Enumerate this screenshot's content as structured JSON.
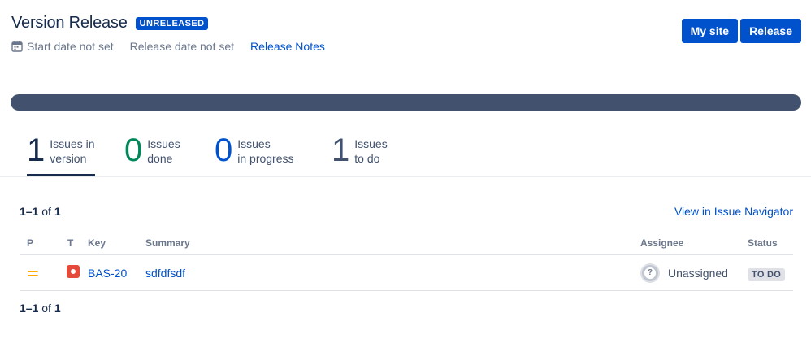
{
  "version": {
    "title": "Version Release",
    "status_badge": "UNRELEASED",
    "start_date": "Start date not set",
    "release_date": "Release date not set",
    "release_notes_link": "Release Notes"
  },
  "actions": {
    "my_site": "My site",
    "release": "Release"
  },
  "progress": {
    "color": "#42526e"
  },
  "stats": [
    {
      "value": "1",
      "label_line1": "Issues in",
      "label_line2": "version",
      "color": "#172b4d",
      "active": true
    },
    {
      "value": "0",
      "label_line1": "Issues",
      "label_line2": "done",
      "color": "#00875a",
      "active": false
    },
    {
      "value": "0",
      "label_line1": "Issues",
      "label_line2": "in progress",
      "color": "#0052cc",
      "active": false
    },
    {
      "value": "1",
      "label_line1": "Issues",
      "label_line2": "to do",
      "color": "#42526e",
      "active": false
    }
  ],
  "results": {
    "range": "1–1",
    "of_text": "of",
    "total": "1",
    "view_link": "View in Issue Navigator"
  },
  "table": {
    "headers": {
      "p": "P",
      "t": "T",
      "key": "Key",
      "summary": "Summary",
      "assignee": "Assignee",
      "status": "Status"
    },
    "rows": [
      {
        "priority_icon": "medium-priority-icon",
        "type_icon": "bug-icon",
        "key": "BAS-20",
        "summary": "sdfdfsdf",
        "assignee": "Unassigned",
        "avatar_glyph": "?",
        "status": "TO DO"
      }
    ]
  },
  "colors": {
    "accent": "#0052cc",
    "text": "#172b4d",
    "done": "#00875a",
    "priority_medium": "#ffab00",
    "bug": "#e5493a"
  }
}
